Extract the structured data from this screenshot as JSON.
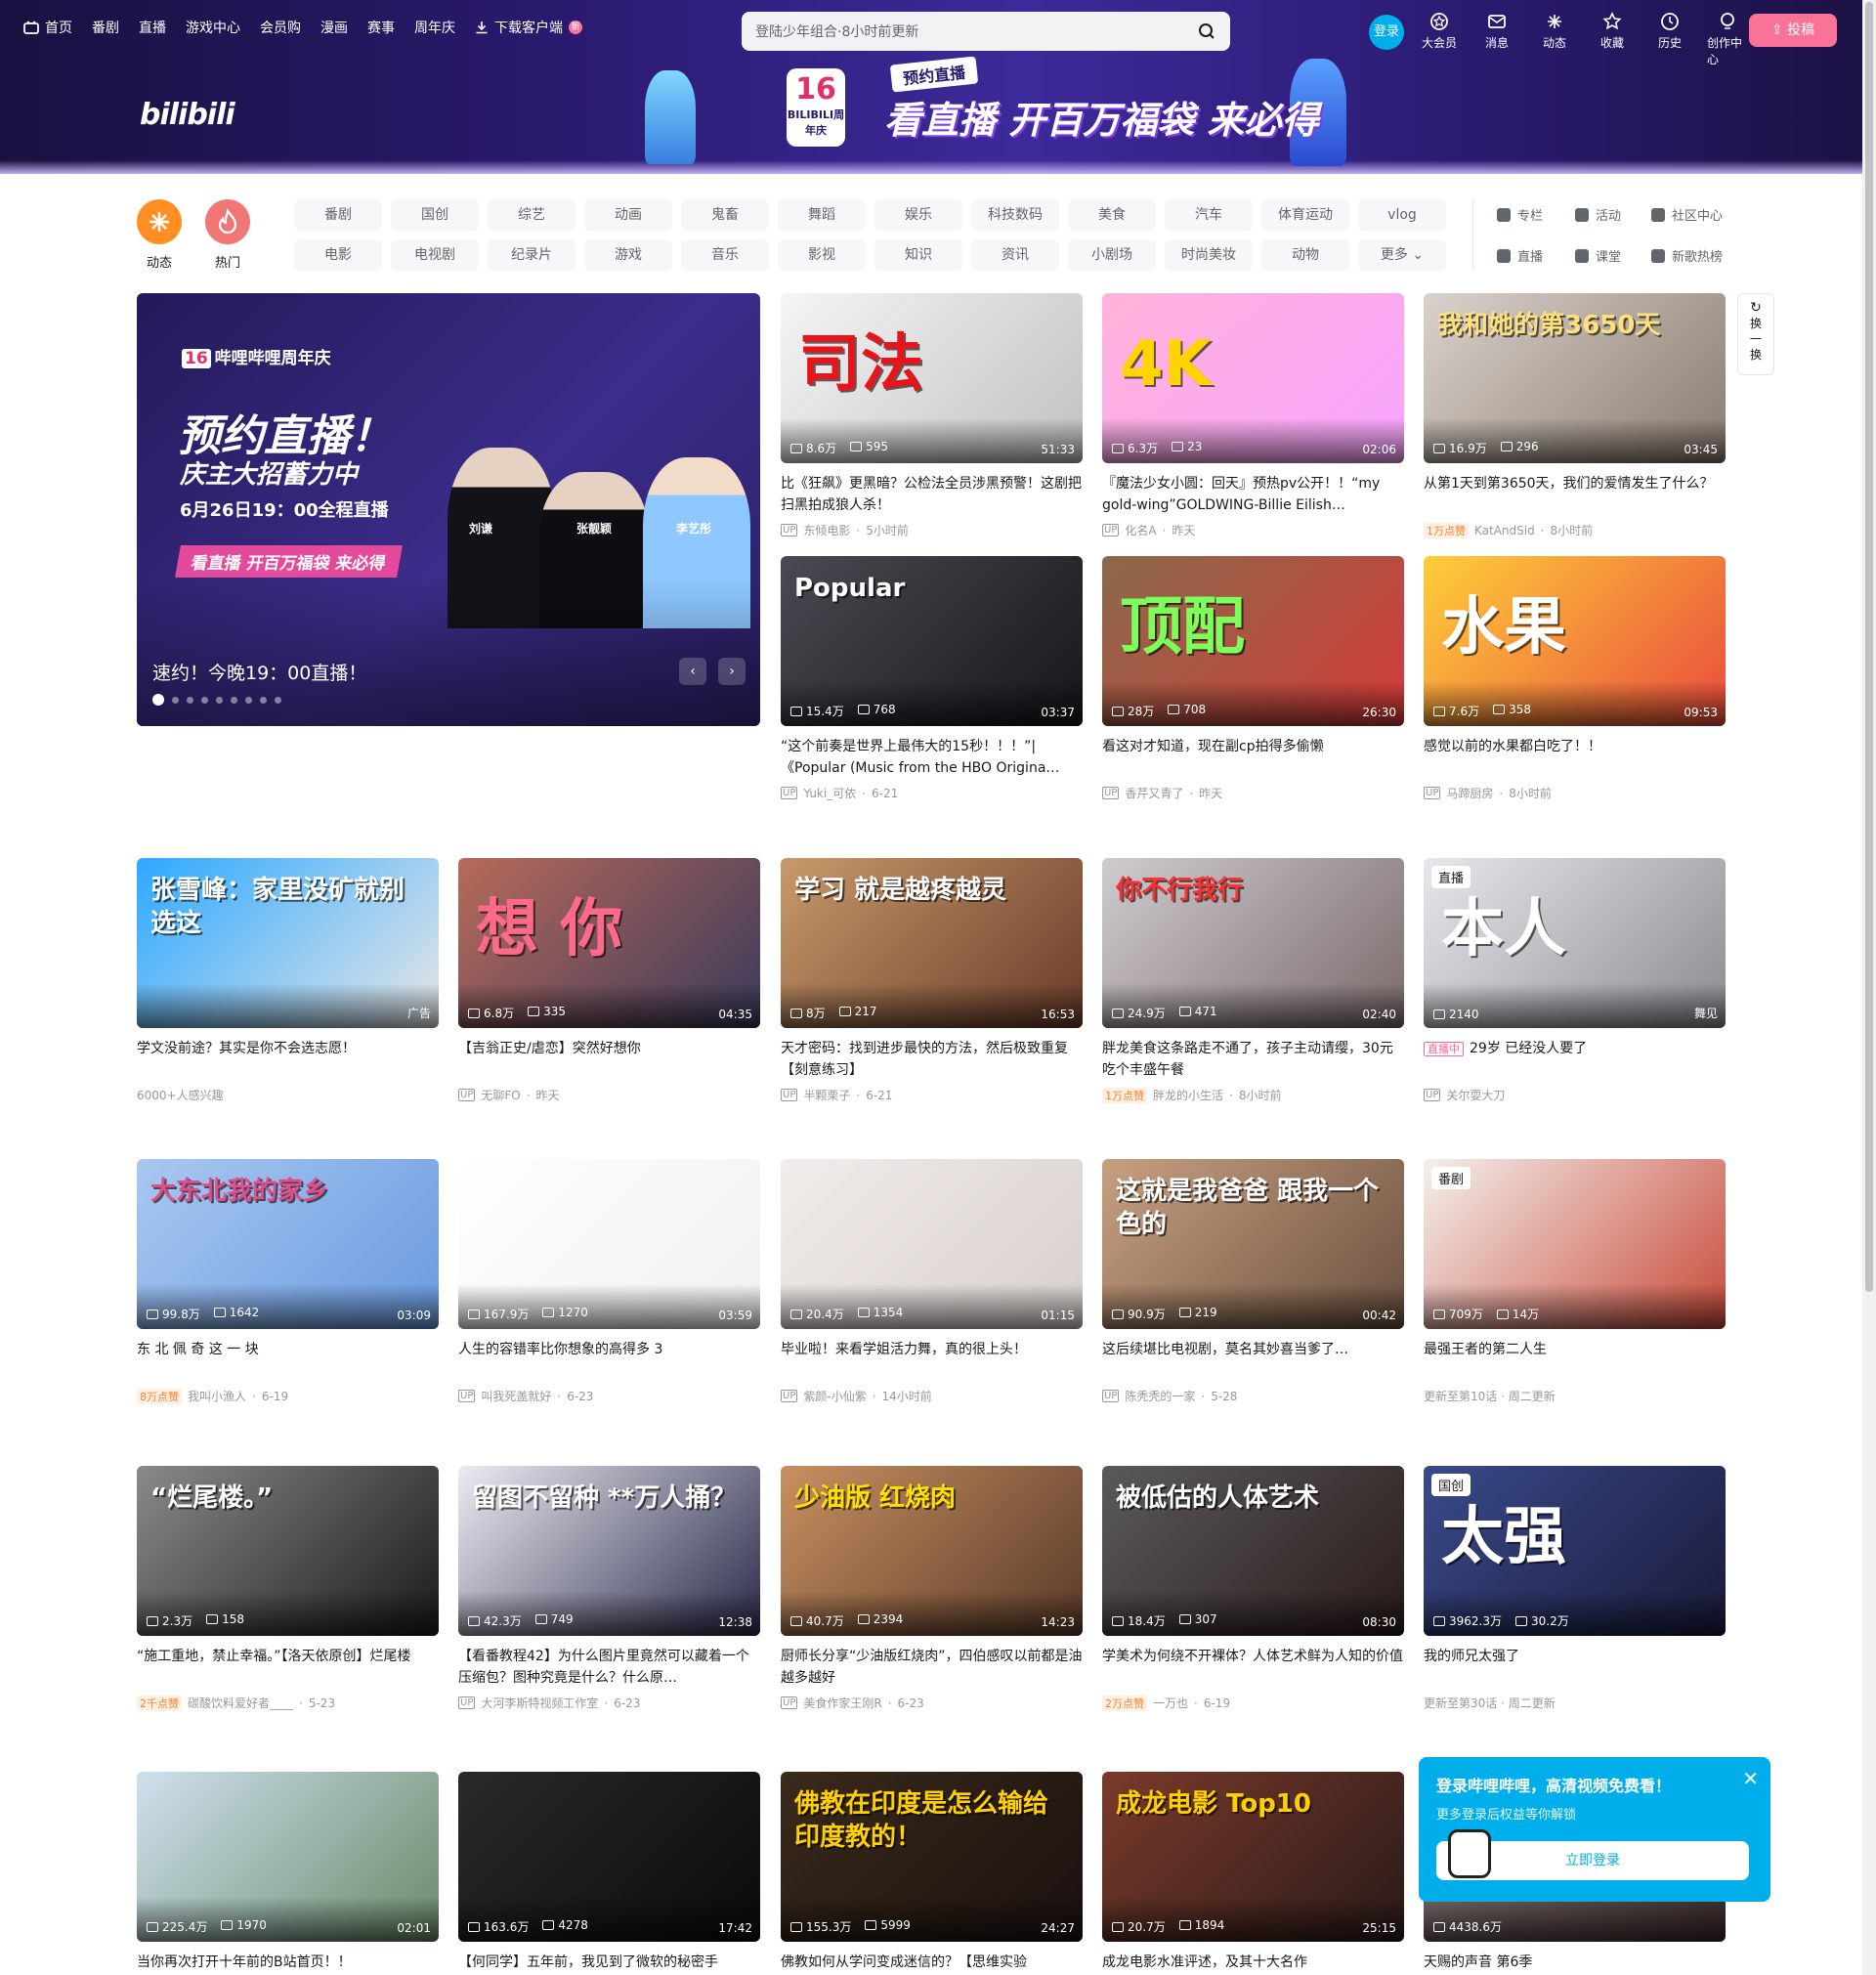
{
  "topnav": {
    "items": [
      "首页",
      "番剧",
      "直播",
      "游戏中心",
      "会员购",
      "漫画",
      "赛事",
      "周年庆",
      "下载客户端"
    ],
    "new_badge": "新"
  },
  "search": {
    "placeholder": "登陆少年组合·8小时前更新"
  },
  "user": {
    "login_label": "登录",
    "items": [
      "大会员",
      "消息",
      "动态",
      "收藏",
      "历史",
      "创作中心"
    ],
    "upload_label": "投稿"
  },
  "banner": {
    "logo": "bilibili",
    "badge_num": "16",
    "badge_text": "BILIBILI周年庆",
    "tag": "预约直播",
    "headline": "看直播 开百万福袋 来必得"
  },
  "channels": {
    "dynamic": "动态",
    "hot": "热门",
    "row1": [
      "番剧",
      "国创",
      "综艺",
      "动画",
      "鬼畜",
      "舞蹈",
      "娱乐",
      "科技数码",
      "美食",
      "汽车",
      "体育运动",
      "vlog"
    ],
    "row2": [
      "电影",
      "电视剧",
      "纪录片",
      "游戏",
      "音乐",
      "影视",
      "知识",
      "资讯",
      "小剧场",
      "时尚美妆",
      "动物",
      "更多"
    ],
    "side": [
      "专栏",
      "活动",
      "社区中心",
      "直播",
      "课堂",
      "新歌热榜"
    ]
  },
  "hero": {
    "brand": "哔哩哔哩周年庆",
    "badge": "16",
    "headline": "预约直播！",
    "sub": "庆主大招蓄力中",
    "time": "6月26日19：00全程直播",
    "cta": "看直播 开百万福袋 来必得",
    "people": [
      "刘谦",
      "张靓颖",
      "李艺彤"
    ],
    "caption": "速约！今晚19：00直播！",
    "prev": "‹",
    "next": "›"
  },
  "refresh": {
    "label": "换一换"
  },
  "cards": [
    {
      "overlay": "司法",
      "views": "8.6万",
      "danmaku": "595",
      "duration": "51:33",
      "title": "比《狂飙》更黑暗？公检法全员涉黑预警！这剧把扫黑拍成狼人杀！",
      "author": "东倾电影",
      "time": "5小时前",
      "badge": "",
      "colors": [
        "#f5f5f5",
        "#c0c0c0"
      ],
      "ovlColor": "#e8141c"
    },
    {
      "overlay": "4K",
      "views": "6.3万",
      "danmaku": "23",
      "duration": "02:06",
      "title": "『魔法少女小圆：回天』预热pv公开！！“my gold-wing”GOLDWING-Billie Eilish…",
      "author": "化名A",
      "time": "昨天",
      "badge": "",
      "colors": [
        "#ffb3d9",
        "#f7a3ff"
      ],
      "ovlColor": "#ffd400"
    },
    {
      "overlay": "我和她的第3650天",
      "views": "16.9万",
      "danmaku": "296",
      "duration": "03:45",
      "title": "从第1天到第3650天，我们的爱情发生了什么？",
      "author": "KatAndSid",
      "time": "8小时前",
      "badge": "1万点赞",
      "colors": [
        "#d9d2cc",
        "#8a7b70"
      ],
      "ovlColor": "#ffe07a"
    },
    {
      "overlay": "Popular",
      "views": "15.4万",
      "danmaku": "768",
      "duration": "03:37",
      "title": "“这个前奏是世界上最伟大的15秒！！！”|《Popular (Music from the HBO Origina…",
      "author": "Yuki_可依",
      "time": "6-21",
      "badge": "",
      "colors": [
        "#4a4a52",
        "#15151a"
      ],
      "ovlColor": "#ffffff"
    },
    {
      "overlay": "顶配",
      "views": "28万",
      "danmaku": "708",
      "duration": "26:30",
      "title": "看这对才知道，现在副cp拍得多偷懒",
      "author": "香芹又青了",
      "time": "昨天",
      "badge": "",
      "colors": [
        "#8a6a4a",
        "#d43a3a"
      ],
      "ovlColor": "#7cff5a"
    },
    {
      "overlay": "水果",
      "views": "7.6万",
      "danmaku": "358",
      "duration": "09:53",
      "title": "感觉以前的水果都白吃了！！",
      "author": "马蹄厨房",
      "time": "8小时前",
      "badge": "",
      "colors": [
        "#ffcf3a",
        "#e84b3c"
      ],
      "ovlColor": "#ffffff"
    },
    {
      "overlay": "张雪峰：家里没矿就别选这",
      "views": "",
      "danmaku": "",
      "duration": "广告",
      "title": "学文没前途？其实是你不会选志愿！",
      "author": "6000+人感兴趣",
      "time": "",
      "badge": "",
      "colors": [
        "#2ea8ff",
        "#e7e7e7"
      ],
      "ovlColor": "#ffffff",
      "ad": true
    },
    {
      "overlay": "想 你",
      "views": "6.8万",
      "danmaku": "335",
      "duration": "04:35",
      "title": "【吉翁正史/虐恋】突然好想你",
      "author": "无聊FO",
      "time": "昨天",
      "badge": "",
      "colors": [
        "#b86a5a",
        "#3a3a5a"
      ],
      "ovlColor": "#ff6a8a"
    },
    {
      "overlay": "学习 就是越疼越灵",
      "views": "8万",
      "danmaku": "217",
      "duration": "16:53",
      "title": "天才密码：找到进步最快的方法，然后极致重复【刻意练习】",
      "author": "半颗栗子",
      "time": "6-21",
      "badge": "",
      "colors": [
        "#c89a6a",
        "#6a3a2a"
      ],
      "ovlColor": "#ffffff"
    },
    {
      "overlay": "你不行我行",
      "views": "24.9万",
      "danmaku": "471",
      "duration": "02:40",
      "title": "胖龙美食这条路走不通了，孩子主动请缨，30元吃个丰盛午餐",
      "author": "胖龙的小生活",
      "time": "8小时前",
      "badge": "1万点赞",
      "colors": [
        "#d0ccd0",
        "#7a6a6a"
      ],
      "ovlColor": "#ff3030"
    },
    {
      "overlay": "本人",
      "views": "2140",
      "danmaku": "",
      "duration": "舞见",
      "title": "29岁 已经没人要了",
      "author": "关尔耍大刀",
      "time": "",
      "badge": "",
      "colors": [
        "#e8e8ec",
        "#8a8a90"
      ],
      "ovlColor": "#ffffff",
      "tagchip": "直播",
      "live": "直播中"
    },
    {
      "overlay": "大东北我的家乡",
      "views": "99.8万",
      "danmaku": "1642",
      "duration": "03:09",
      "title": "东 北 佩 奇 这 一 块",
      "author": "我叫小渔人",
      "time": "6-19",
      "badge": "8万点赞",
      "colors": [
        "#a8c8f0",
        "#6a9ae0"
      ],
      "ovlColor": "#e84b8a"
    },
    {
      "overlay": "",
      "views": "167.9万",
      "danmaku": "1270",
      "duration": "03:59",
      "title": "人生的容错率比你想象的高得多 3",
      "author": "叫我死盖就好",
      "time": "6-23",
      "badge": "",
      "colors": [
        "#ffffff",
        "#f0f0f0"
      ],
      "ovlColor": "#000000"
    },
    {
      "overlay": "",
      "views": "20.4万",
      "danmaku": "1354",
      "duration": "01:15",
      "title": "毕业啦！来看学姐活力舞，真的很上头！",
      "author": "紫颜-小仙紫",
      "time": "14小时前",
      "badge": "",
      "colors": [
        "#f2ecea",
        "#d6cfcc"
      ],
      "ovlColor": "#ffffff"
    },
    {
      "overlay": "这就是我爸爸  跟我一个色的",
      "views": "90.9万",
      "danmaku": "219",
      "duration": "00:42",
      "title": "这后续堪比电视剧，莫名其妙喜当爹了…",
      "author": "陈秃秃的一家",
      "time": "5-28",
      "badge": "",
      "colors": [
        "#c8a080",
        "#6a5040"
      ],
      "ovlColor": "#ffffff"
    },
    {
      "overlay": "",
      "views": "709万",
      "danmaku": "14万",
      "duration": "",
      "title": "最强王者的第二人生",
      "author": "更新至第10话 · 周二更新",
      "time": "",
      "badge": "",
      "colors": [
        "#f4f0ec",
        "#c84a3a"
      ],
      "ovlColor": "#ffffff",
      "tagchip": "番剧",
      "bangumi": true
    },
    {
      "overlay": "“烂尾楼。”",
      "views": "2.3万",
      "danmaku": "158",
      "duration": "",
      "title": "“施工重地，禁止幸福。”【洛天依原创】烂尾楼",
      "author": "碳酸饮料爱好者____",
      "time": "5-23",
      "badge": "2千点赞",
      "colors": [
        "#8a8a8a",
        "#1a1a1a"
      ],
      "ovlColor": "#ffffff"
    },
    {
      "overlay": "留图不留种 **万人捅？",
      "views": "42.3万",
      "danmaku": "749",
      "duration": "12:38",
      "title": "【看番教程42】为什么图片里竟然可以藏着一个压缩包？图种究竟是什么？什么原…",
      "author": "大河李斯特视频工作室",
      "time": "6-23",
      "badge": "",
      "colors": [
        "#ececf4",
        "#2a2a4a"
      ],
      "ovlColor": "#ffffff"
    },
    {
      "overlay": "少油版 红烧肉",
      "views": "40.7万",
      "danmaku": "2394",
      "duration": "14:23",
      "title": "厨师长分享“少油版红烧肉”，四伯感叹以前都是油越多越好",
      "author": "美食作家王刚R",
      "time": "6-23",
      "badge": "",
      "colors": [
        "#c89060",
        "#5a3a2a"
      ],
      "ovlColor": "#ffe000"
    },
    {
      "overlay": "被低估的人体艺术",
      "views": "18.4万",
      "danmaku": "307",
      "duration": "08:30",
      "title": "学美术为何绕不开裸体？人体艺术鲜为人知的价值",
      "author": "一万也",
      "time": "6-19",
      "badge": "2万点赞",
      "colors": [
        "#5a5a5a",
        "#2a1a1a"
      ],
      "ovlColor": "#ffffff"
    },
    {
      "overlay": "太强",
      "views": "3962.3万",
      "danmaku": "30.2万",
      "duration": "",
      "title": "我的师兄太强了",
      "author": "更新至第30话 · 周二更新",
      "time": "",
      "badge": "",
      "colors": [
        "#3a4a8a",
        "#1a1a3a"
      ],
      "ovlColor": "#ffffff",
      "tagchip": "国创",
      "bangumi": true
    },
    {
      "overlay": "",
      "views": "225.4万",
      "danmaku": "1970",
      "duration": "02:01",
      "title": "当你再次打开十年前的B站首页！！",
      "author": "",
      "time": "",
      "badge": "",
      "colors": [
        "#cfe0ee",
        "#6a8a6a"
      ],
      "ovlColor": "#ffffff"
    },
    {
      "overlay": "",
      "views": "163.6万",
      "danmaku": "4278",
      "duration": "17:42",
      "title": "【何同学】五年前，我见到了微软的秘密手",
      "author": "",
      "time": "",
      "badge": "",
      "colors": [
        "#2a2a2a",
        "#0a0a0a"
      ],
      "ovlColor": "#ffffff"
    },
    {
      "overlay": "佛教在印度是怎么输给印度教的！",
      "views": "155.3万",
      "danmaku": "5999",
      "duration": "24:27",
      "title": "佛教如何从学问变成迷信的？【思维实验",
      "author": "",
      "time": "",
      "badge": "",
      "colors": [
        "#3a2a1a",
        "#1a1010"
      ],
      "ovlColor": "#ffd000"
    },
    {
      "overlay": "成龙电影 Top10",
      "views": "20.7万",
      "danmaku": "1894",
      "duration": "25:15",
      "title": "成龙电影水准评述，及其十大名作",
      "author": "",
      "time": "",
      "badge": "",
      "colors": [
        "#7a3a2a",
        "#2a1a1a"
      ],
      "ovlColor": "#ffd000"
    },
    {
      "overlay": "",
      "views": "4438.6万",
      "danmaku": "",
      "duration": "",
      "title": "天赐的声音 第6季",
      "author": "",
      "time": "",
      "badge": "",
      "colors": [
        "#8a7a7a",
        "#3a2a2a"
      ],
      "ovlColor": "#ffffff"
    }
  ],
  "popup": {
    "title": "登录哔哩哔哩，高清视频免费看！",
    "sub": "更多登录后权益等你解锁",
    "button": "立即登录",
    "close": "✕"
  },
  "colors": {
    "brand_pink": "#fb7299",
    "brand_blue": "#00aeec",
    "orange": "#ff7f24"
  }
}
